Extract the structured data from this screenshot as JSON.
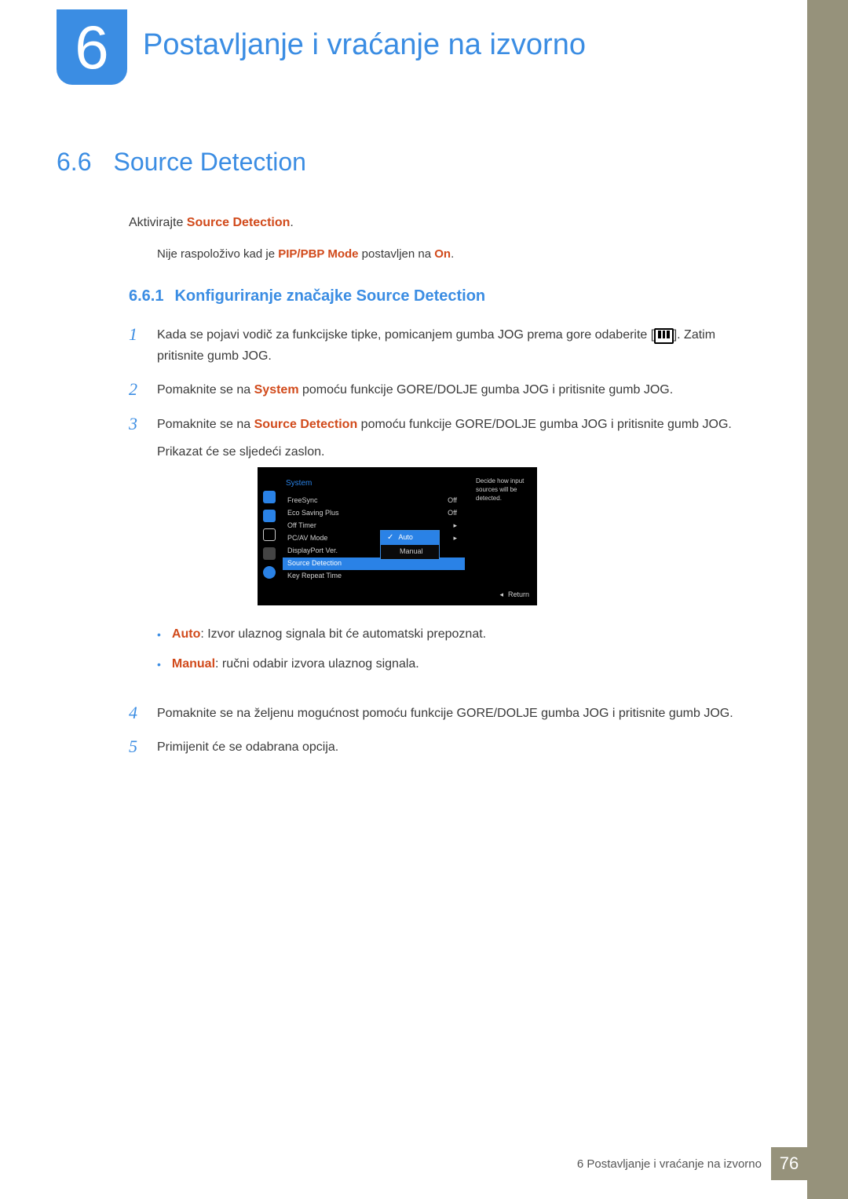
{
  "chapter": {
    "number": "6",
    "title": "Postavljanje i vraćanje na izvorno"
  },
  "section": {
    "number": "6.6",
    "title": "Source Detection"
  },
  "intro": {
    "pre": "Aktivirajte ",
    "kw": "Source Detection",
    "post": "."
  },
  "note": {
    "p1": "Nije raspoloživo kad je ",
    "kw1": "PIP/PBP Mode",
    "p2": " postavljen na ",
    "kw2": "On",
    "p3": "."
  },
  "subsection": {
    "number": "6.6.1",
    "title": "Konfiguriranje značajke Source Detection"
  },
  "steps": {
    "s1": {
      "n": "1",
      "a": "Kada se pojavi vodič za funkcijske tipke, pomicanjem gumba JOG prema gore odaberite [",
      "b": "]. Zatim pritisnite gumb JOG."
    },
    "s2": {
      "n": "2",
      "a": "Pomaknite se na ",
      "kw": "System",
      "b": " pomoću funkcije GORE/DOLJE gumba JOG i pritisnite gumb JOG."
    },
    "s3": {
      "n": "3",
      "a": "Pomaknite se na ",
      "kw": "Source Detection",
      "b": " pomoću funkcije GORE/DOLJE gumba JOG i pritisnite gumb JOG.",
      "c": "Prikazat će se sljedeći zaslon."
    },
    "s4": {
      "n": "4",
      "a": "Pomaknite se na željenu mogućnost pomoću funkcije GORE/DOLJE gumba JOG i pritisnite gumb JOG."
    },
    "s5": {
      "n": "5",
      "a": "Primijenit će se odabrana opcija."
    }
  },
  "osd": {
    "title": "System",
    "rows": [
      {
        "label": "FreeSync",
        "value": "Off"
      },
      {
        "label": "Eco Saving Plus",
        "value": "Off"
      },
      {
        "label": "Off Timer",
        "value": "▸"
      },
      {
        "label": "PC/AV Mode",
        "value": "▸"
      },
      {
        "label": "DisplayPort Ver.",
        "value": ""
      },
      {
        "label": "Source Detection",
        "value": ""
      },
      {
        "label": "Key Repeat Time",
        "value": ""
      }
    ],
    "sublabels": {
      "auto": "Auto",
      "manual": "Manual"
    },
    "help": "Decide how input sources will be detected.",
    "return": "Return"
  },
  "bullets": {
    "b1": {
      "kw": "Auto",
      "txt": ": Izvor ulaznog signala bit će automatski prepoznat."
    },
    "b2": {
      "kw": "Manual",
      "txt": ": ručni odabir izvora ulaznog signala."
    }
  },
  "footer": {
    "label": "6 Postavljanje i vraćanje na izvorno",
    "page": "76"
  }
}
